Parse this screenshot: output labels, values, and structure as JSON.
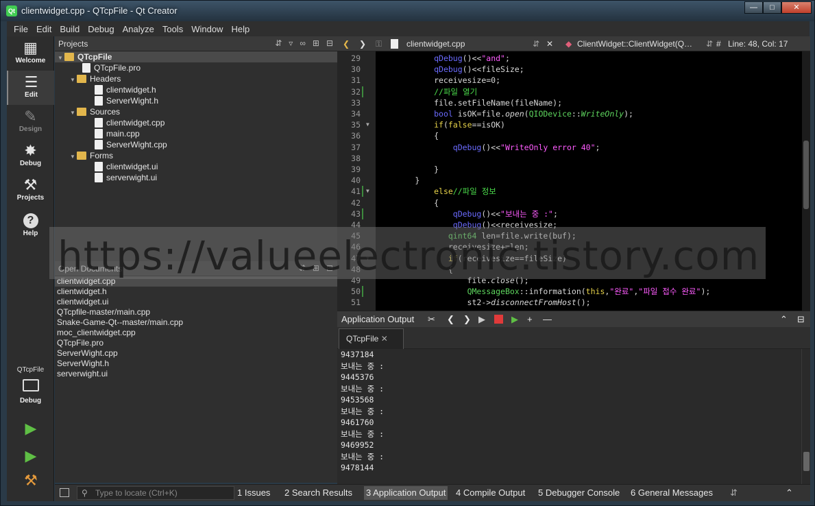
{
  "window": {
    "title": "clientwidget.cpp - QTcpFile - Qt Creator",
    "app_icon": "Qt"
  },
  "menu": [
    "File",
    "Edit",
    "Build",
    "Debug",
    "Analyze",
    "Tools",
    "Window",
    "Help"
  ],
  "modes": [
    {
      "label": "Welcome",
      "icon": "grid-icon"
    },
    {
      "label": "Edit",
      "icon": "document-icon"
    },
    {
      "label": "Design",
      "icon": "pencil-icon"
    },
    {
      "label": "Debug",
      "icon": "bug-icon"
    },
    {
      "label": "Projects",
      "icon": "wrench-icon"
    },
    {
      "label": "Help",
      "icon": "help-icon"
    }
  ],
  "kit": {
    "name": "QTcpFile",
    "config": "Debug"
  },
  "projects": {
    "header": "Projects",
    "tree": [
      {
        "label": "QTcpFile",
        "level": 0,
        "type": "project",
        "expanded": true
      },
      {
        "label": "QTcpFile.pro",
        "level": 1,
        "type": "file"
      },
      {
        "label": "Headers",
        "level": 1,
        "type": "folder",
        "expanded": true
      },
      {
        "label": "clientwidget.h",
        "level": 2,
        "type": "file"
      },
      {
        "label": "ServerWight.h",
        "level": 2,
        "type": "file"
      },
      {
        "label": "Sources",
        "level": 1,
        "type": "folder",
        "expanded": true
      },
      {
        "label": "clientwidget.cpp",
        "level": 2,
        "type": "file"
      },
      {
        "label": "main.cpp",
        "level": 2,
        "type": "file"
      },
      {
        "label": "ServerWight.cpp",
        "level": 2,
        "type": "file"
      },
      {
        "label": "Forms",
        "level": 1,
        "type": "folder",
        "expanded": true
      },
      {
        "label": "clientwidget.ui",
        "level": 2,
        "type": "file"
      },
      {
        "label": "serverwight.ui",
        "level": 2,
        "type": "file"
      }
    ]
  },
  "open_documents": {
    "header": "Open Documents",
    "items": [
      "clientwidget.cpp",
      "clientwidget.h",
      "clientwidget.ui",
      "QTcpfile-master/main.cpp",
      "Snake-Game-Qt--master/main.cpp",
      "moc_clientwidget.cpp",
      "QTcpFile.pro",
      "ServerWight.cpp",
      "ServerWight.h",
      "serverwight.ui"
    ],
    "selected": 0
  },
  "editor": {
    "file": "clientwidget.cpp",
    "symbol": "ClientWidget::ClientWidget(Q…",
    "position": "Line: 48, Col: 17",
    "hash": "#",
    "lines": [
      {
        "n": "29",
        "html": "            <span class=\"f\">qDebug</span>()&lt;&lt;<span class=\"s\">\"and\"</span>;"
      },
      {
        "n": "30",
        "html": "            <span class=\"f\">qDebug</span>()&lt;&lt;fileSize;"
      },
      {
        "n": "31",
        "html": "            receivesize=0;"
      },
      {
        "n": "32",
        "html": "            <span class=\"c\">//파일 열기</span>",
        "changed": true
      },
      {
        "n": "33",
        "html": "            file.setFileName(fileName);"
      },
      {
        "n": "34",
        "html": "            <span class=\"f\">bool</span> isOK=file.<span class=\"it\">open</span>(<span class=\"t\">QIODevice</span>::<span class=\"t it\">WriteOnly</span>);"
      },
      {
        "n": "35",
        "html": "            <span class=\"k\">if</span>(<span class=\"k\">false</span>==isOK)",
        "fold": true
      },
      {
        "n": "36",
        "html": "            {"
      },
      {
        "n": "37",
        "html": "                <span class=\"f\">qDebug</span>()&lt;&lt;<span class=\"s\">\"WriteOnly error 40\"</span>;"
      },
      {
        "n": "38",
        "html": ""
      },
      {
        "n": "39",
        "html": "            }"
      },
      {
        "n": "40",
        "html": "        }"
      },
      {
        "n": "41",
        "html": "            <span class=\"k\">else</span><span class=\"c\">//파일 정보</span>",
        "fold": true,
        "changed": true
      },
      {
        "n": "42",
        "html": "            {"
      },
      {
        "n": "43",
        "html": "                <span class=\"f\">qDebug</span>()&lt;&lt;<span class=\"s\">\"보내는 중 :\"</span>;",
        "changed": true
      },
      {
        "n": "44",
        "html": "                <span class=\"f\">qDebug</span>()&lt;&lt;receivesize;"
      },
      {
        "n": "45",
        "html": "               <span class=\"t\">qint64</span> len=file.write(buf);"
      },
      {
        "n": "46",
        "html": "               receivesize+=len;"
      },
      {
        "n": "47",
        "html": "               <span class=\"k\">if</span>(receivesize==fileSize)",
        "fold": true
      },
      {
        "n": "48",
        "html": "               {"
      },
      {
        "n": "49",
        "html": "                   file.<span class=\"it\">close</span>();"
      },
      {
        "n": "50",
        "html": "                   <span class=\"t\">QMessageBox</span>::information(<span class=\"k\">this</span>,<span class=\"s\">\"완료\"</span>,<span class=\"s\">\"파일 접수 완료\"</span>);",
        "changed": true
      },
      {
        "n": "51",
        "html": "                   st2-&gt;<span class=\"it\">disconnectFromHost</span>();"
      }
    ]
  },
  "output": {
    "title": "Application Output",
    "tab": "QTcpFile",
    "lines": [
      "9437184",
      "보내는 중 :",
      "9445376",
      "보내는 중 :",
      "9453568",
      "보내는 중 :",
      "9461760",
      "보내는 중 :",
      "9469952",
      "보내는 중 :",
      "9478144"
    ]
  },
  "statusbar": {
    "locator_placeholder": "Type to locate (Ctrl+K)",
    "tabs": [
      {
        "num": "1",
        "label": "Issues"
      },
      {
        "num": "2",
        "label": "Search Results"
      },
      {
        "num": "3",
        "label": "Application Output",
        "selected": true
      },
      {
        "num": "4",
        "label": "Compile Output"
      },
      {
        "num": "5",
        "label": "Debugger Console"
      },
      {
        "num": "6",
        "label": "General Messages"
      }
    ]
  },
  "watermark": "https://valueelectronic.tistory.com"
}
